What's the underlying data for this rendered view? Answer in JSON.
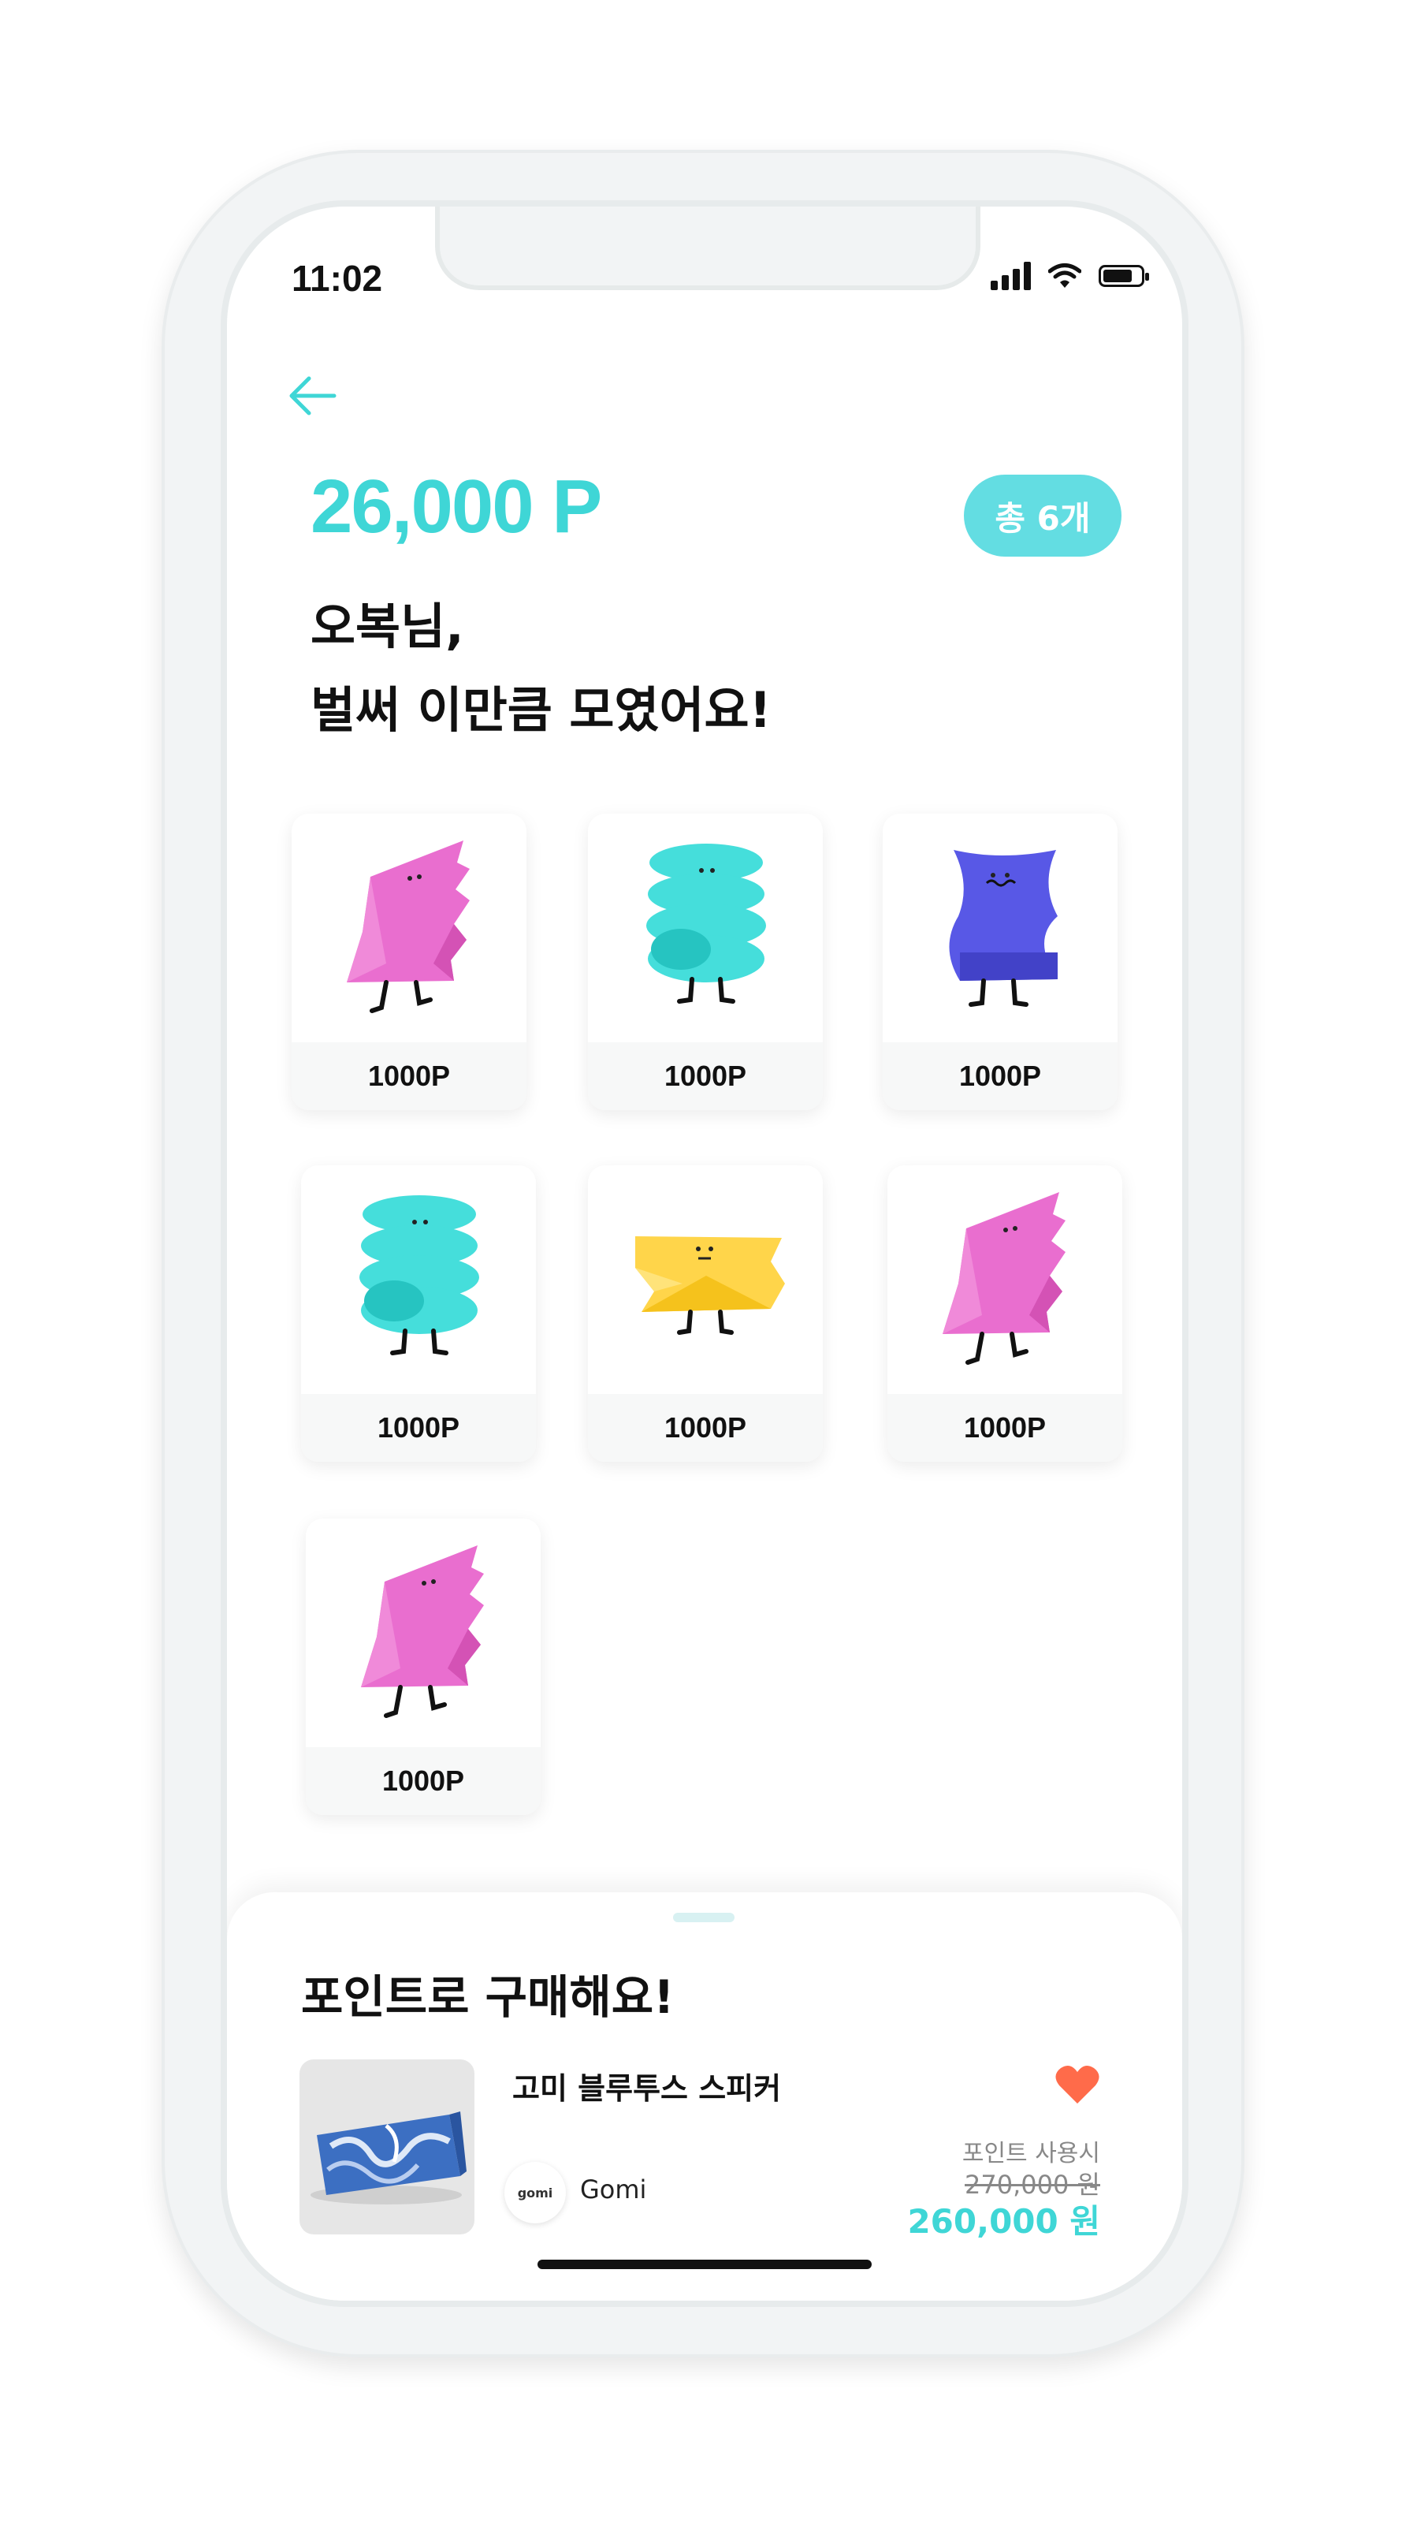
{
  "status_bar": {
    "time": "11:02"
  },
  "header": {
    "points": "26,000 P",
    "count_badge": "총 6개"
  },
  "greeting": {
    "line1": "오복님,",
    "line2": "벌써 이만큼 모였어요!"
  },
  "cards": [
    {
      "label": "1000P",
      "character": "pink-character"
    },
    {
      "label": "1000P",
      "character": "cyan-character"
    },
    {
      "label": "1000P",
      "character": "blue-character"
    },
    {
      "label": "1000P",
      "character": "cyan-character"
    },
    {
      "label": "1000P",
      "character": "yellow-character"
    },
    {
      "label": "1000P",
      "character": "pink-character"
    },
    {
      "label": "1000P",
      "character": "pink-character"
    }
  ],
  "purchase": {
    "title": "포인트로 구매해요!",
    "product_name": "고미 블루투스 스피커",
    "brand_logo_text": "gomi",
    "brand_name": "Gomi",
    "price_note": "포인트 사용시",
    "price_original": "270,000 원",
    "price_discounted": "260,000 원"
  },
  "colors": {
    "accent": "#3fd6d6",
    "badge": "#63dde2",
    "pink": "#e96ecf",
    "cyan": "#45dedb",
    "blue": "#5858e6",
    "yellow": "#ffd54a",
    "heart": "#ff6b4a"
  }
}
